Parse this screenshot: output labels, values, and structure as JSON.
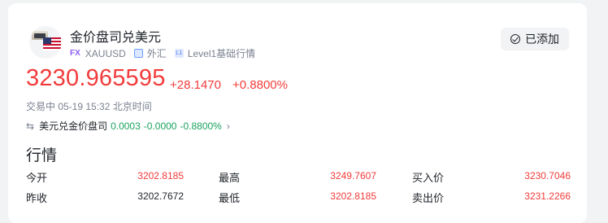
{
  "header": {
    "title": "金价盘司兑美元",
    "badge": "FX",
    "symbol": "XAUUSD",
    "market": "外汇",
    "data_level": "Level1基础行情",
    "added_button": "已添加"
  },
  "quote": {
    "price": "3230.965595",
    "change": "+28.1470",
    "change_pct": "+0.8800%",
    "status": "交易中 05-19 15:32 北京时间"
  },
  "conversion": {
    "label": "美元兑金价盘司",
    "value": "0.0003",
    "change": "-0.0000",
    "change_pct": "-0.8800%"
  },
  "section_title": "行情",
  "rows": [
    {
      "l1": "今开",
      "v1": "3202.8185",
      "l2": "最高",
      "v2": "3249.7607",
      "l3": "买入价",
      "v3": "3230.7046"
    },
    {
      "l1": "昨收",
      "v1": "3202.7672",
      "l2": "最低",
      "v2": "3202.8185",
      "l3": "卖出价",
      "v3": "3231.2266"
    }
  ],
  "colors": {
    "up": "#f23b3b",
    "down": "#1aa35f"
  }
}
